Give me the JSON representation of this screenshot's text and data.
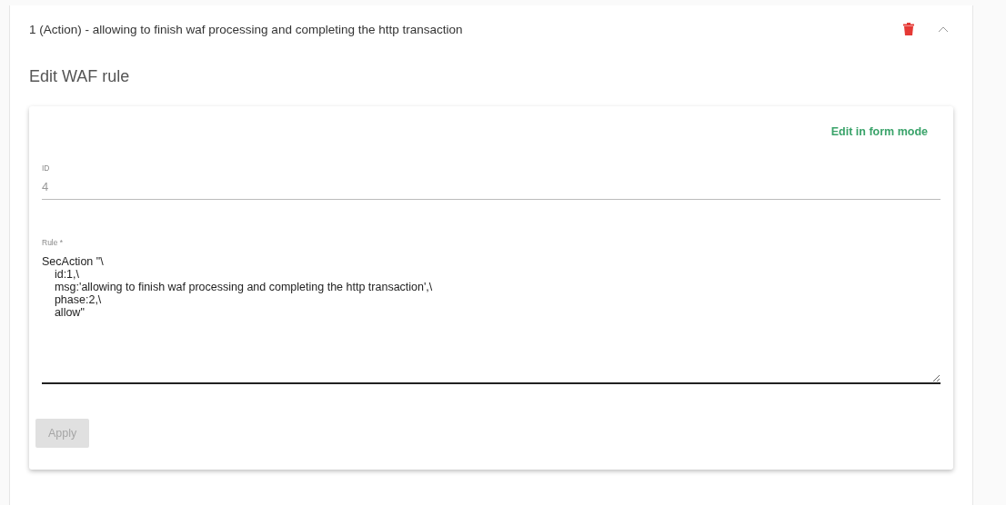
{
  "panel": {
    "title": "1 (Action) - allowing to finish waf processing and completing the http transaction",
    "expanded": true
  },
  "heading": "Edit WAF rule",
  "mode_link": "Edit in form mode",
  "fields": [
    {
      "kind": "input",
      "label": "ID",
      "value": "4",
      "disabled": true
    },
    {
      "kind": "textarea",
      "label": "Rule *",
      "value": "SecAction \"\\\n\tid:1,\\\n\tmsg:'allowing to finish waf processing and completing the http transaction',\\\n\tphase:2,\\\n\tallow\"",
      "disabled": false
    }
  ],
  "apply_button": {
    "label": "Apply",
    "disabled": true
  }
}
